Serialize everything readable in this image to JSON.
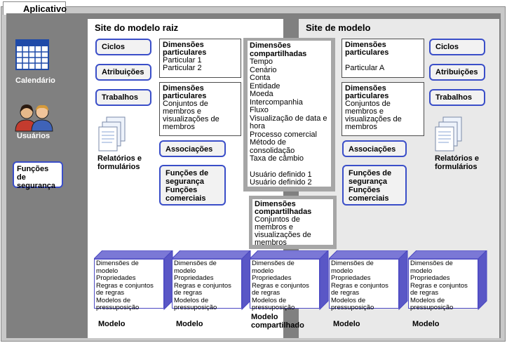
{
  "app": {
    "tab_label": "Aplicativo"
  },
  "sidebar": {
    "calendar_label": "Calendário",
    "users_label": "Usuários",
    "security_label": "Funções de segurança"
  },
  "root_site": {
    "title": "Site do modelo raiz",
    "pills": [
      "Ciclos",
      "Atribuições",
      "Trabalhos"
    ],
    "reports_label": "Relatórios e formulários",
    "private_dims": {
      "title": "Dimensões particulares",
      "items": [
        "Particular 1",
        "Particular 2"
      ]
    },
    "member_sets": {
      "title": "Dimensões particulares",
      "body": "Conjuntos de membros e visualizações de membros"
    },
    "associations": "Associações",
    "functions": "Funções de segurança Funções comerciais"
  },
  "shared": {
    "title": "Dimensões compartilhadas",
    "items": [
      "Tempo",
      "Cenário",
      "Conta",
      "Entidade",
      "Moeda",
      "Intercompanhia",
      "Fluxo",
      "Visualização de data e hora",
      "Processo comercial",
      "Método de consolidação",
      "Taxa de câmbio",
      "",
      "Usuário definido 1",
      "Usuário definido 2"
    ],
    "member_sets_title": "Dimensões compartilhadas",
    "member_sets_body": "Conjuntos de membros e visualizações de membros"
  },
  "model_site": {
    "title": "Site de modelo",
    "pills": [
      "Ciclos",
      "Atribuições",
      "Trabalhos"
    ],
    "reports_label": "Relatórios e formulários",
    "private_dims": {
      "title": "Dimensões particulares",
      "items": [
        "Particular A"
      ]
    },
    "member_sets": {
      "title": "Dimensões particulares",
      "body": "Conjuntos de membros e visualizações de membros"
    },
    "associations": "Associações",
    "functions": "Funções de segurança Funções comerciais"
  },
  "models": [
    {
      "label": "Modelo",
      "lines": [
        "Dimensões de modelo",
        "Propriedades",
        "Regras e conjuntos de regras",
        "Modelos de pressuposição"
      ]
    },
    {
      "label": "Modelo",
      "lines": [
        "Dimensões de modelo",
        "Propriedades",
        "Regras e conjuntos de regras",
        "Modelos de pressuposição"
      ]
    },
    {
      "label": "Modelo compartilhado",
      "lines": [
        "Dimensões de modelo",
        "Propriedades",
        "Regras e conjuntos de regras",
        "Modelos de pressuposição"
      ]
    },
    {
      "label": "Modelo",
      "lines": [
        "Dimensões de modelo",
        "Propriedades",
        "Regras e conjuntos de regras",
        "Modelos de pressuposição"
      ]
    },
    {
      "label": "Modelo",
      "lines": [
        "Dimensões de modelo",
        "Propriedades",
        "Regras e conjuntos de regras",
        "Modelos de pressuposição"
      ]
    }
  ],
  "colors": {
    "accent": "#3a4ec8",
    "frame": "#808080",
    "model_site_bg": "#e9e9e9"
  }
}
